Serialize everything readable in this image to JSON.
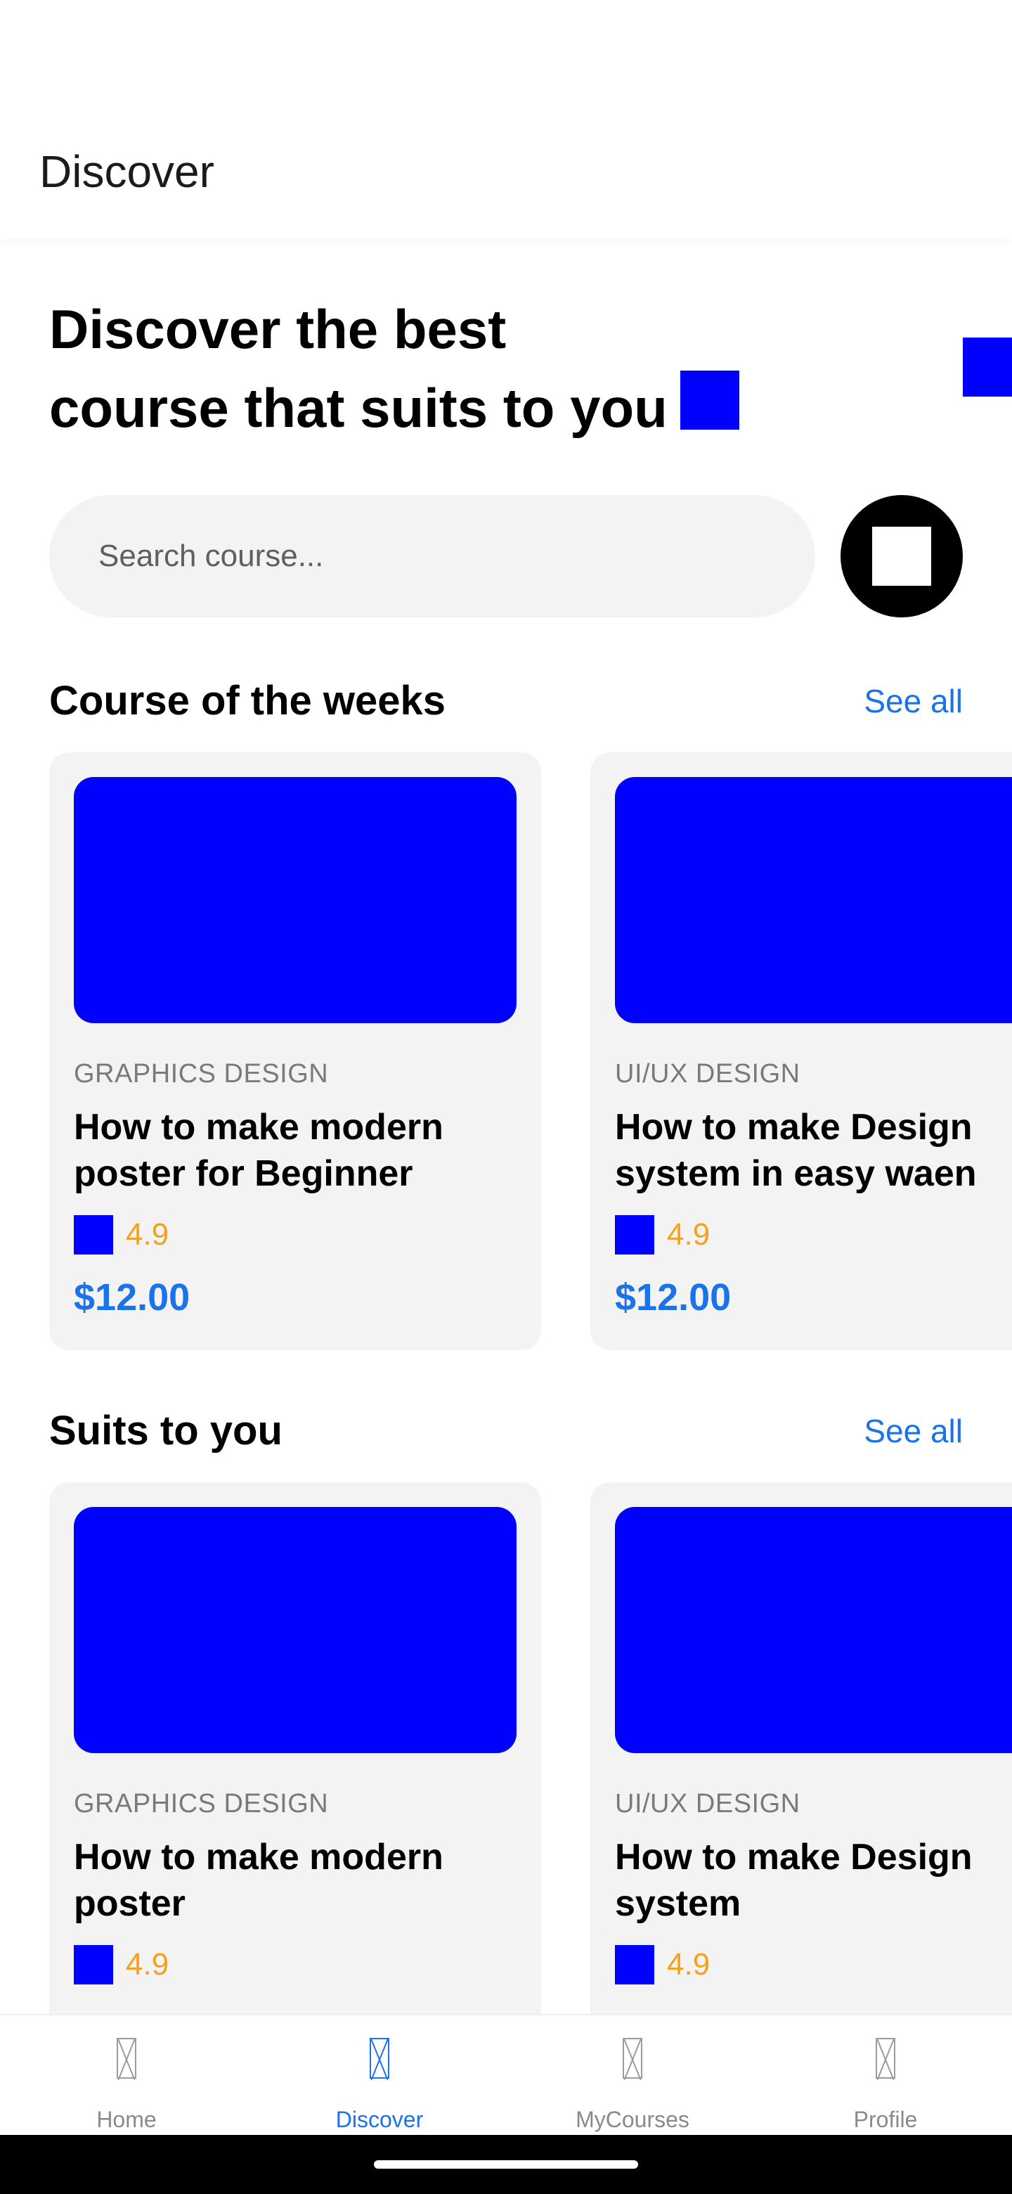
{
  "appbar": {
    "title": "Discover"
  },
  "hero": {
    "line1": "Discover the best",
    "line2": "course that suits to you"
  },
  "search": {
    "placeholder": "Search course..."
  },
  "sections": [
    {
      "title": "Course of the weeks",
      "see_all": "See all",
      "cards": [
        {
          "category": "GRAPHICS DESIGN",
          "title": "How to make modern\nposter for Beginner",
          "rating": "4.9",
          "price": "$12.00"
        },
        {
          "category": "UI/UX DESIGN",
          "title": "How to make Design\nsystem in easy waen",
          "rating": "4.9",
          "price": "$12.00"
        }
      ]
    },
    {
      "title": "Suits to you",
      "see_all": "See all",
      "cards": [
        {
          "category": "GRAPHICS DESIGN",
          "title": "How to make modern\nposter",
          "rating": "4.9"
        },
        {
          "category": "UI/UX DESIGN",
          "title": "How to make Design\nsystem",
          "rating": "4.9"
        }
      ]
    }
  ],
  "bottom_nav": {
    "items": [
      {
        "label": "Home",
        "icon": "broken-image-icon"
      },
      {
        "label": "Discover",
        "icon": "broken-image-icon",
        "active": true
      },
      {
        "label": "MyCourses",
        "icon": "broken-image-icon"
      },
      {
        "label": "Profile",
        "icon": "broken-image-icon"
      }
    ]
  },
  "colors": {
    "accent": "#1a73e8",
    "placeholder_image": "#0000ff",
    "rating": "#f4a21d",
    "card_bg": "#f3f3f3"
  }
}
